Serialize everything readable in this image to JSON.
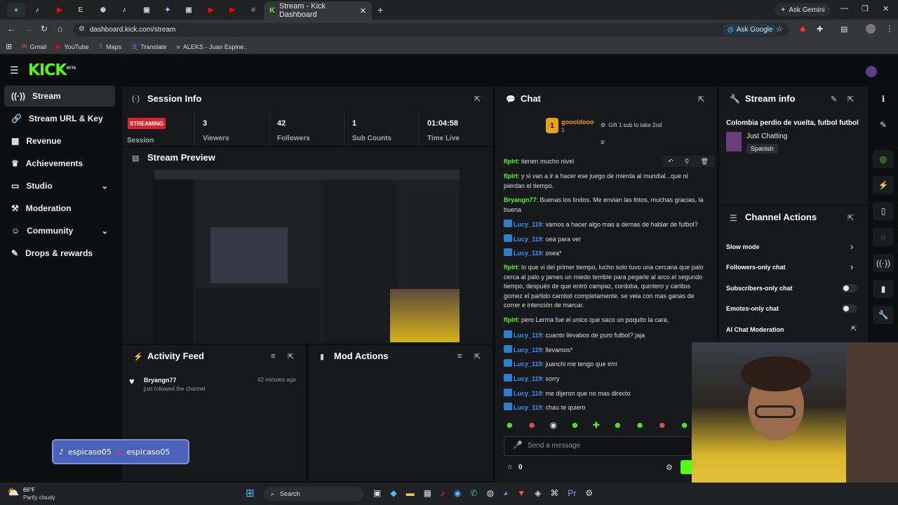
{
  "browser": {
    "tab_title": "Stream - Kick Dashboard",
    "url": "dashboard.kick.com/stream",
    "ask_gemini": "Ask Gemini",
    "ask_google": "Ask Google",
    "bookmarks": [
      "Gmail",
      "YouTube",
      "Maps",
      "Translate",
      "ALEKS - Juan Espine..."
    ]
  },
  "logo": "KICK",
  "logo_badge": "BETA",
  "sidebar": {
    "items": [
      {
        "label": "Stream",
        "icon": "broadcast-icon"
      },
      {
        "label": "Stream URL & Key",
        "icon": "link-icon"
      },
      {
        "label": "Revenue",
        "icon": "bank-icon"
      },
      {
        "label": "Achievements",
        "icon": "trophy-icon"
      },
      {
        "label": "Studio",
        "icon": "monitor-icon"
      },
      {
        "label": "Moderation",
        "icon": "hammer-icon"
      },
      {
        "label": "Community",
        "icon": "people-icon"
      },
      {
        "label": "Drops & rewards",
        "icon": "gift-icon"
      }
    ]
  },
  "session": {
    "title": "Session Info",
    "badge": "STREAMING",
    "badge_label": "Session",
    "stats": [
      {
        "value": "3",
        "label": "Viewers"
      },
      {
        "value": "42",
        "label": "Followers"
      },
      {
        "value": "1",
        "label": "Sub Counts"
      },
      {
        "value": "01:04:58",
        "label": "Time Live"
      }
    ]
  },
  "preview": {
    "title": "Stream Preview"
  },
  "activity": {
    "title": "Activity Feed",
    "items": [
      {
        "user": "Bryangn77",
        "text": "just followed the channel",
        "time": "42 minutes ago"
      }
    ]
  },
  "mod_actions": {
    "title": "Mod Actions"
  },
  "overlay": {
    "tiktok": "espicaso05",
    "instagram": "espicaso05"
  },
  "chat": {
    "title": "Chat",
    "pinned_user": "goooldooo",
    "pinned_count": "1",
    "pinned_gift": "Gift 1 sub to take 2nd",
    "messages": [
      {
        "user": "flplrt",
        "text": "tienen mucho nivel",
        "color": "#53fc18",
        "badge": false
      },
      {
        "user": "flplrt",
        "text": "y si van a ir a hacer ese juego de mierda al mundial...que ni pierdan el tiempo.",
        "color": "#53fc18",
        "badge": false
      },
      {
        "user": "Bryangn77",
        "text": "Buenas los lindos. Me envian las fotos, muchas gracias, la buena",
        "color": "#53fc18",
        "badge": false
      },
      {
        "user": "Lucy_119",
        "text": "vamos a hacer algo mas a demas de hablar de futbol?",
        "color": "#3b92f5",
        "badge": true
      },
      {
        "user": "Lucy_119",
        "text": "oea para ver",
        "color": "#3b92f5",
        "badge": true
      },
      {
        "user": "Lucy_119",
        "text": "osea*",
        "color": "#3b92f5",
        "badge": true
      },
      {
        "user": "flplrt",
        "text": "lo que vi del primer tiempo, lucho solo tuvo una cercana que palo cerca al palo y james un miedo terrible para pegarle al arco.el segundo tiempo, después de que entró campaz, cordoba, quintero y carlitos gomez el partido cambió completamente. se veia con mas ganas de correr e intención de marcar.",
        "color": "#53fc18",
        "badge": false
      },
      {
        "user": "flplrt",
        "text": "pero Lerma fue el unico que saco un poquito la cara.",
        "color": "#53fc18",
        "badge": false
      },
      {
        "user": "Lucy_119",
        "text": "cuanto llevabos de puro futbol? jaja",
        "color": "#3b92f5",
        "badge": true
      },
      {
        "user": "Lucy_119",
        "text": "llevamos*",
        "color": "#3b92f5",
        "badge": true
      },
      {
        "user": "Lucy_119",
        "text": "juanchi me tengo que irrrr",
        "color": "#3b92f5",
        "badge": true
      },
      {
        "user": "Lucy_119",
        "text": "sorry",
        "color": "#3b92f5",
        "badge": true
      },
      {
        "user": "Lucy_119",
        "text": "me dijeron que no mas directo",
        "color": "#3b92f5",
        "badge": true
      },
      {
        "user": "Lucy_119",
        "text": "chau te quiero",
        "color": "#3b92f5",
        "badge": true
      }
    ],
    "placeholder": "Send a message",
    "count": "0"
  },
  "stream_info": {
    "title": "Stream info",
    "stream_title": "Colombia perdio de vuelta, futbol futbol",
    "category": "Just Chatting",
    "language": "Spanish"
  },
  "channel_actions": {
    "title": "Channel Actions",
    "items": [
      {
        "label": "Slow mode",
        "control": "chevron"
      },
      {
        "label": "Followers-only chat",
        "control": "chevron"
      },
      {
        "label": "Subscribers-only chat",
        "control": "toggle"
      },
      {
        "label": "Emotes-only chat",
        "control": "toggle"
      },
      {
        "label": "AI Chat Moderation",
        "control": "external"
      }
    ]
  },
  "taskbar": {
    "weather_temp": "66°F",
    "weather_text": "Partly cloudy",
    "search": "Search"
  },
  "colors": {
    "accent": "#53fc18",
    "panel": "#17181b",
    "streaming": "#d9222b"
  }
}
